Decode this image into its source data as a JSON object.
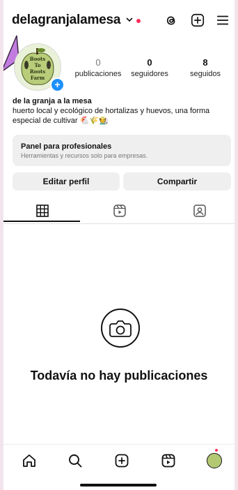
{
  "profile": {
    "username": "delagranjalamesa",
    "avatar_text": [
      "Boots",
      "To",
      "Roots",
      "Farm"
    ],
    "name": "de la granja a la mesa",
    "bio": "huerto local y ecológico de hortalizas y huevos, una forma especial de cultivar 🐔🌾🧑‍🌾"
  },
  "stats": [
    {
      "value": "0",
      "label": "publicaciones"
    },
    {
      "value": "0",
      "label": "seguidores"
    },
    {
      "value": "8",
      "label": "seguidos"
    }
  ],
  "panel": {
    "title": "Panel para profesionales",
    "subtitle": "Herramientas y recursos solo para empresas."
  },
  "buttons": {
    "edit": "Editar perfil",
    "share": "Compartir"
  },
  "tabs": [
    "grid-icon",
    "reels-icon",
    "tagged-icon"
  ],
  "empty_state": {
    "title": "Todavía no hay publicaciones"
  },
  "colors": {
    "accent_blue": "#1e90ff",
    "notification_red": "#ff2e5a",
    "annotation_arrow": "#c27be0"
  },
  "bottom_nav": [
    "home-icon",
    "search-icon",
    "create-icon",
    "reels-icon",
    "profile-avatar"
  ]
}
